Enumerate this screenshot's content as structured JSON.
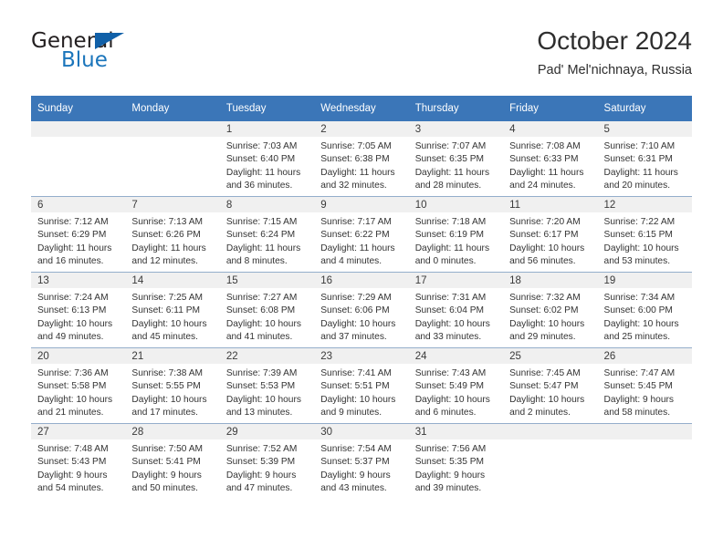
{
  "brand": {
    "name_part1": "General",
    "name_part2": "Blue",
    "logo_icon": "blue-triangle-icon",
    "color_primary": "#1b75bb",
    "color_text": "#231f20"
  },
  "header": {
    "title": "October 2024",
    "subtitle": "Pad' Mel'nichnaya, Russia"
  },
  "calendar": {
    "header_background": "#3b76b8",
    "header_text_color": "#ffffff",
    "weekdays": [
      "Sunday",
      "Monday",
      "Tuesday",
      "Wednesday",
      "Thursday",
      "Friday",
      "Saturday"
    ],
    "weeks": [
      [
        {
          "day": "",
          "sunrise": "",
          "sunset": "",
          "daylight_line1": "",
          "daylight_line2": ""
        },
        {
          "day": "",
          "sunrise": "",
          "sunset": "",
          "daylight_line1": "",
          "daylight_line2": ""
        },
        {
          "day": "1",
          "sunrise": "Sunrise: 7:03 AM",
          "sunset": "Sunset: 6:40 PM",
          "daylight_line1": "Daylight: 11 hours",
          "daylight_line2": "and 36 minutes."
        },
        {
          "day": "2",
          "sunrise": "Sunrise: 7:05 AM",
          "sunset": "Sunset: 6:38 PM",
          "daylight_line1": "Daylight: 11 hours",
          "daylight_line2": "and 32 minutes."
        },
        {
          "day": "3",
          "sunrise": "Sunrise: 7:07 AM",
          "sunset": "Sunset: 6:35 PM",
          "daylight_line1": "Daylight: 11 hours",
          "daylight_line2": "and 28 minutes."
        },
        {
          "day": "4",
          "sunrise": "Sunrise: 7:08 AM",
          "sunset": "Sunset: 6:33 PM",
          "daylight_line1": "Daylight: 11 hours",
          "daylight_line2": "and 24 minutes."
        },
        {
          "day": "5",
          "sunrise": "Sunrise: 7:10 AM",
          "sunset": "Sunset: 6:31 PM",
          "daylight_line1": "Daylight: 11 hours",
          "daylight_line2": "and 20 minutes."
        }
      ],
      [
        {
          "day": "6",
          "sunrise": "Sunrise: 7:12 AM",
          "sunset": "Sunset: 6:29 PM",
          "daylight_line1": "Daylight: 11 hours",
          "daylight_line2": "and 16 minutes."
        },
        {
          "day": "7",
          "sunrise": "Sunrise: 7:13 AM",
          "sunset": "Sunset: 6:26 PM",
          "daylight_line1": "Daylight: 11 hours",
          "daylight_line2": "and 12 minutes."
        },
        {
          "day": "8",
          "sunrise": "Sunrise: 7:15 AM",
          "sunset": "Sunset: 6:24 PM",
          "daylight_line1": "Daylight: 11 hours",
          "daylight_line2": "and 8 minutes."
        },
        {
          "day": "9",
          "sunrise": "Sunrise: 7:17 AM",
          "sunset": "Sunset: 6:22 PM",
          "daylight_line1": "Daylight: 11 hours",
          "daylight_line2": "and 4 minutes."
        },
        {
          "day": "10",
          "sunrise": "Sunrise: 7:18 AM",
          "sunset": "Sunset: 6:19 PM",
          "daylight_line1": "Daylight: 11 hours",
          "daylight_line2": "and 0 minutes."
        },
        {
          "day": "11",
          "sunrise": "Sunrise: 7:20 AM",
          "sunset": "Sunset: 6:17 PM",
          "daylight_line1": "Daylight: 10 hours",
          "daylight_line2": "and 56 minutes."
        },
        {
          "day": "12",
          "sunrise": "Sunrise: 7:22 AM",
          "sunset": "Sunset: 6:15 PM",
          "daylight_line1": "Daylight: 10 hours",
          "daylight_line2": "and 53 minutes."
        }
      ],
      [
        {
          "day": "13",
          "sunrise": "Sunrise: 7:24 AM",
          "sunset": "Sunset: 6:13 PM",
          "daylight_line1": "Daylight: 10 hours",
          "daylight_line2": "and 49 minutes."
        },
        {
          "day": "14",
          "sunrise": "Sunrise: 7:25 AM",
          "sunset": "Sunset: 6:11 PM",
          "daylight_line1": "Daylight: 10 hours",
          "daylight_line2": "and 45 minutes."
        },
        {
          "day": "15",
          "sunrise": "Sunrise: 7:27 AM",
          "sunset": "Sunset: 6:08 PM",
          "daylight_line1": "Daylight: 10 hours",
          "daylight_line2": "and 41 minutes."
        },
        {
          "day": "16",
          "sunrise": "Sunrise: 7:29 AM",
          "sunset": "Sunset: 6:06 PM",
          "daylight_line1": "Daylight: 10 hours",
          "daylight_line2": "and 37 minutes."
        },
        {
          "day": "17",
          "sunrise": "Sunrise: 7:31 AM",
          "sunset": "Sunset: 6:04 PM",
          "daylight_line1": "Daylight: 10 hours",
          "daylight_line2": "and 33 minutes."
        },
        {
          "day": "18",
          "sunrise": "Sunrise: 7:32 AM",
          "sunset": "Sunset: 6:02 PM",
          "daylight_line1": "Daylight: 10 hours",
          "daylight_line2": "and 29 minutes."
        },
        {
          "day": "19",
          "sunrise": "Sunrise: 7:34 AM",
          "sunset": "Sunset: 6:00 PM",
          "daylight_line1": "Daylight: 10 hours",
          "daylight_line2": "and 25 minutes."
        }
      ],
      [
        {
          "day": "20",
          "sunrise": "Sunrise: 7:36 AM",
          "sunset": "Sunset: 5:58 PM",
          "daylight_line1": "Daylight: 10 hours",
          "daylight_line2": "and 21 minutes."
        },
        {
          "day": "21",
          "sunrise": "Sunrise: 7:38 AM",
          "sunset": "Sunset: 5:55 PM",
          "daylight_line1": "Daylight: 10 hours",
          "daylight_line2": "and 17 minutes."
        },
        {
          "day": "22",
          "sunrise": "Sunrise: 7:39 AM",
          "sunset": "Sunset: 5:53 PM",
          "daylight_line1": "Daylight: 10 hours",
          "daylight_line2": "and 13 minutes."
        },
        {
          "day": "23",
          "sunrise": "Sunrise: 7:41 AM",
          "sunset": "Sunset: 5:51 PM",
          "daylight_line1": "Daylight: 10 hours",
          "daylight_line2": "and 9 minutes."
        },
        {
          "day": "24",
          "sunrise": "Sunrise: 7:43 AM",
          "sunset": "Sunset: 5:49 PM",
          "daylight_line1": "Daylight: 10 hours",
          "daylight_line2": "and 6 minutes."
        },
        {
          "day": "25",
          "sunrise": "Sunrise: 7:45 AM",
          "sunset": "Sunset: 5:47 PM",
          "daylight_line1": "Daylight: 10 hours",
          "daylight_line2": "and 2 minutes."
        },
        {
          "day": "26",
          "sunrise": "Sunrise: 7:47 AM",
          "sunset": "Sunset: 5:45 PM",
          "daylight_line1": "Daylight: 9 hours",
          "daylight_line2": "and 58 minutes."
        }
      ],
      [
        {
          "day": "27",
          "sunrise": "Sunrise: 7:48 AM",
          "sunset": "Sunset: 5:43 PM",
          "daylight_line1": "Daylight: 9 hours",
          "daylight_line2": "and 54 minutes."
        },
        {
          "day": "28",
          "sunrise": "Sunrise: 7:50 AM",
          "sunset": "Sunset: 5:41 PM",
          "daylight_line1": "Daylight: 9 hours",
          "daylight_line2": "and 50 minutes."
        },
        {
          "day": "29",
          "sunrise": "Sunrise: 7:52 AM",
          "sunset": "Sunset: 5:39 PM",
          "daylight_line1": "Daylight: 9 hours",
          "daylight_line2": "and 47 minutes."
        },
        {
          "day": "30",
          "sunrise": "Sunrise: 7:54 AM",
          "sunset": "Sunset: 5:37 PM",
          "daylight_line1": "Daylight: 9 hours",
          "daylight_line2": "and 43 minutes."
        },
        {
          "day": "31",
          "sunrise": "Sunrise: 7:56 AM",
          "sunset": "Sunset: 5:35 PM",
          "daylight_line1": "Daylight: 9 hours",
          "daylight_line2": "and 39 minutes."
        },
        {
          "day": "",
          "sunrise": "",
          "sunset": "",
          "daylight_line1": "",
          "daylight_line2": ""
        },
        {
          "day": "",
          "sunrise": "",
          "sunset": "",
          "daylight_line1": "",
          "daylight_line2": ""
        }
      ]
    ]
  }
}
